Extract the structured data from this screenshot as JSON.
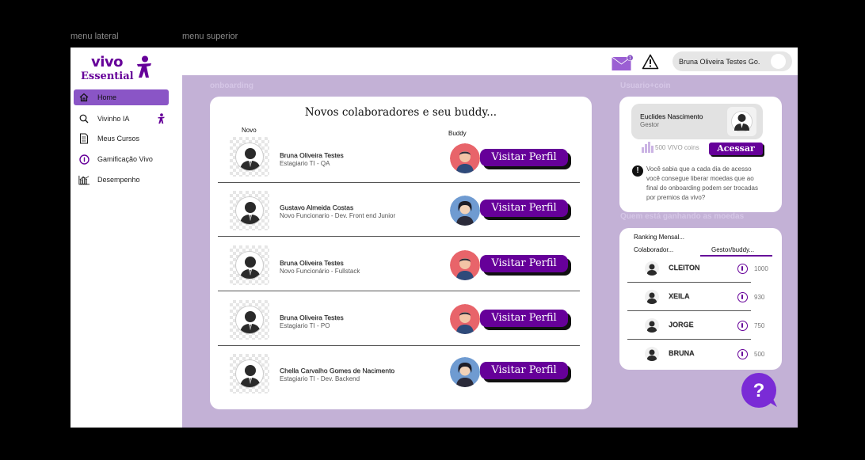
{
  "frame_labels": {
    "side": "menu lateral",
    "top": "menu superior"
  },
  "brand": {
    "line1": "vivo",
    "line2": "Essential",
    "color": "#660099"
  },
  "sidebar": {
    "items": [
      {
        "label": "Home",
        "icon": "home-icon",
        "active": true
      },
      {
        "label": "Vivinho IA",
        "icon": "search-icon"
      },
      {
        "label": "Meus Cursos",
        "icon": "document-icon"
      },
      {
        "label": "Gamificação Vivo",
        "icon": "coin-icon"
      },
      {
        "label": "Desempenho",
        "icon": "bar-chart-icon"
      }
    ]
  },
  "topbar": {
    "mail_badge": "1",
    "user_name": "Bruna Oliveira Testes Go."
  },
  "sections": {
    "onboarding": "onboarding",
    "usuario_coin": "Usuario+coin",
    "quem": "Quem está ganhando as moedas"
  },
  "onboarding": {
    "title": "Novos colaboradores e seu buddy...",
    "col_novo": "Novo",
    "col_buddy": "Buddy",
    "button_label": "Visitar Perfil",
    "rows": [
      {
        "name": "Bruna Oliveira Testes",
        "role": "Estagiario TI - QA"
      },
      {
        "name": "Gustavo Almeida Costas",
        "role": "Novo Funcionario - Dev. Front end Junior"
      },
      {
        "name": "Bruna Oliveira Testes",
        "role": "Novo Funcionário - Fullstack"
      },
      {
        "name": "Bruna Oliveira Testes",
        "role": "Estagiario TI - PO"
      },
      {
        "name": "Chella Carvalho Gomes de Nacimento",
        "role": "Estagiario TI - Dev. Backend"
      }
    ]
  },
  "coin_card": {
    "name": "Euclides Nascimento",
    "role": "Gestor",
    "coins": "500 VIVO coins",
    "button": "Acessar",
    "tip": "Você sabia que a cada dia de acesso você consegue liberar moedas que ao final do onboarding podem ser trocadas por premios da vivo?"
  },
  "ranking": {
    "title": "Ranking Mensal...",
    "tab_colaborador": "Colaborador...",
    "tab_gestor": "Gestor/buddy...",
    "rows": [
      {
        "name": "CLEITON",
        "value": "1000"
      },
      {
        "name": "XEILA",
        "value": "930"
      },
      {
        "name": "JORGE",
        "value": "750"
      },
      {
        "name": "BRUNA",
        "value": "500"
      }
    ]
  },
  "help_label": "?"
}
